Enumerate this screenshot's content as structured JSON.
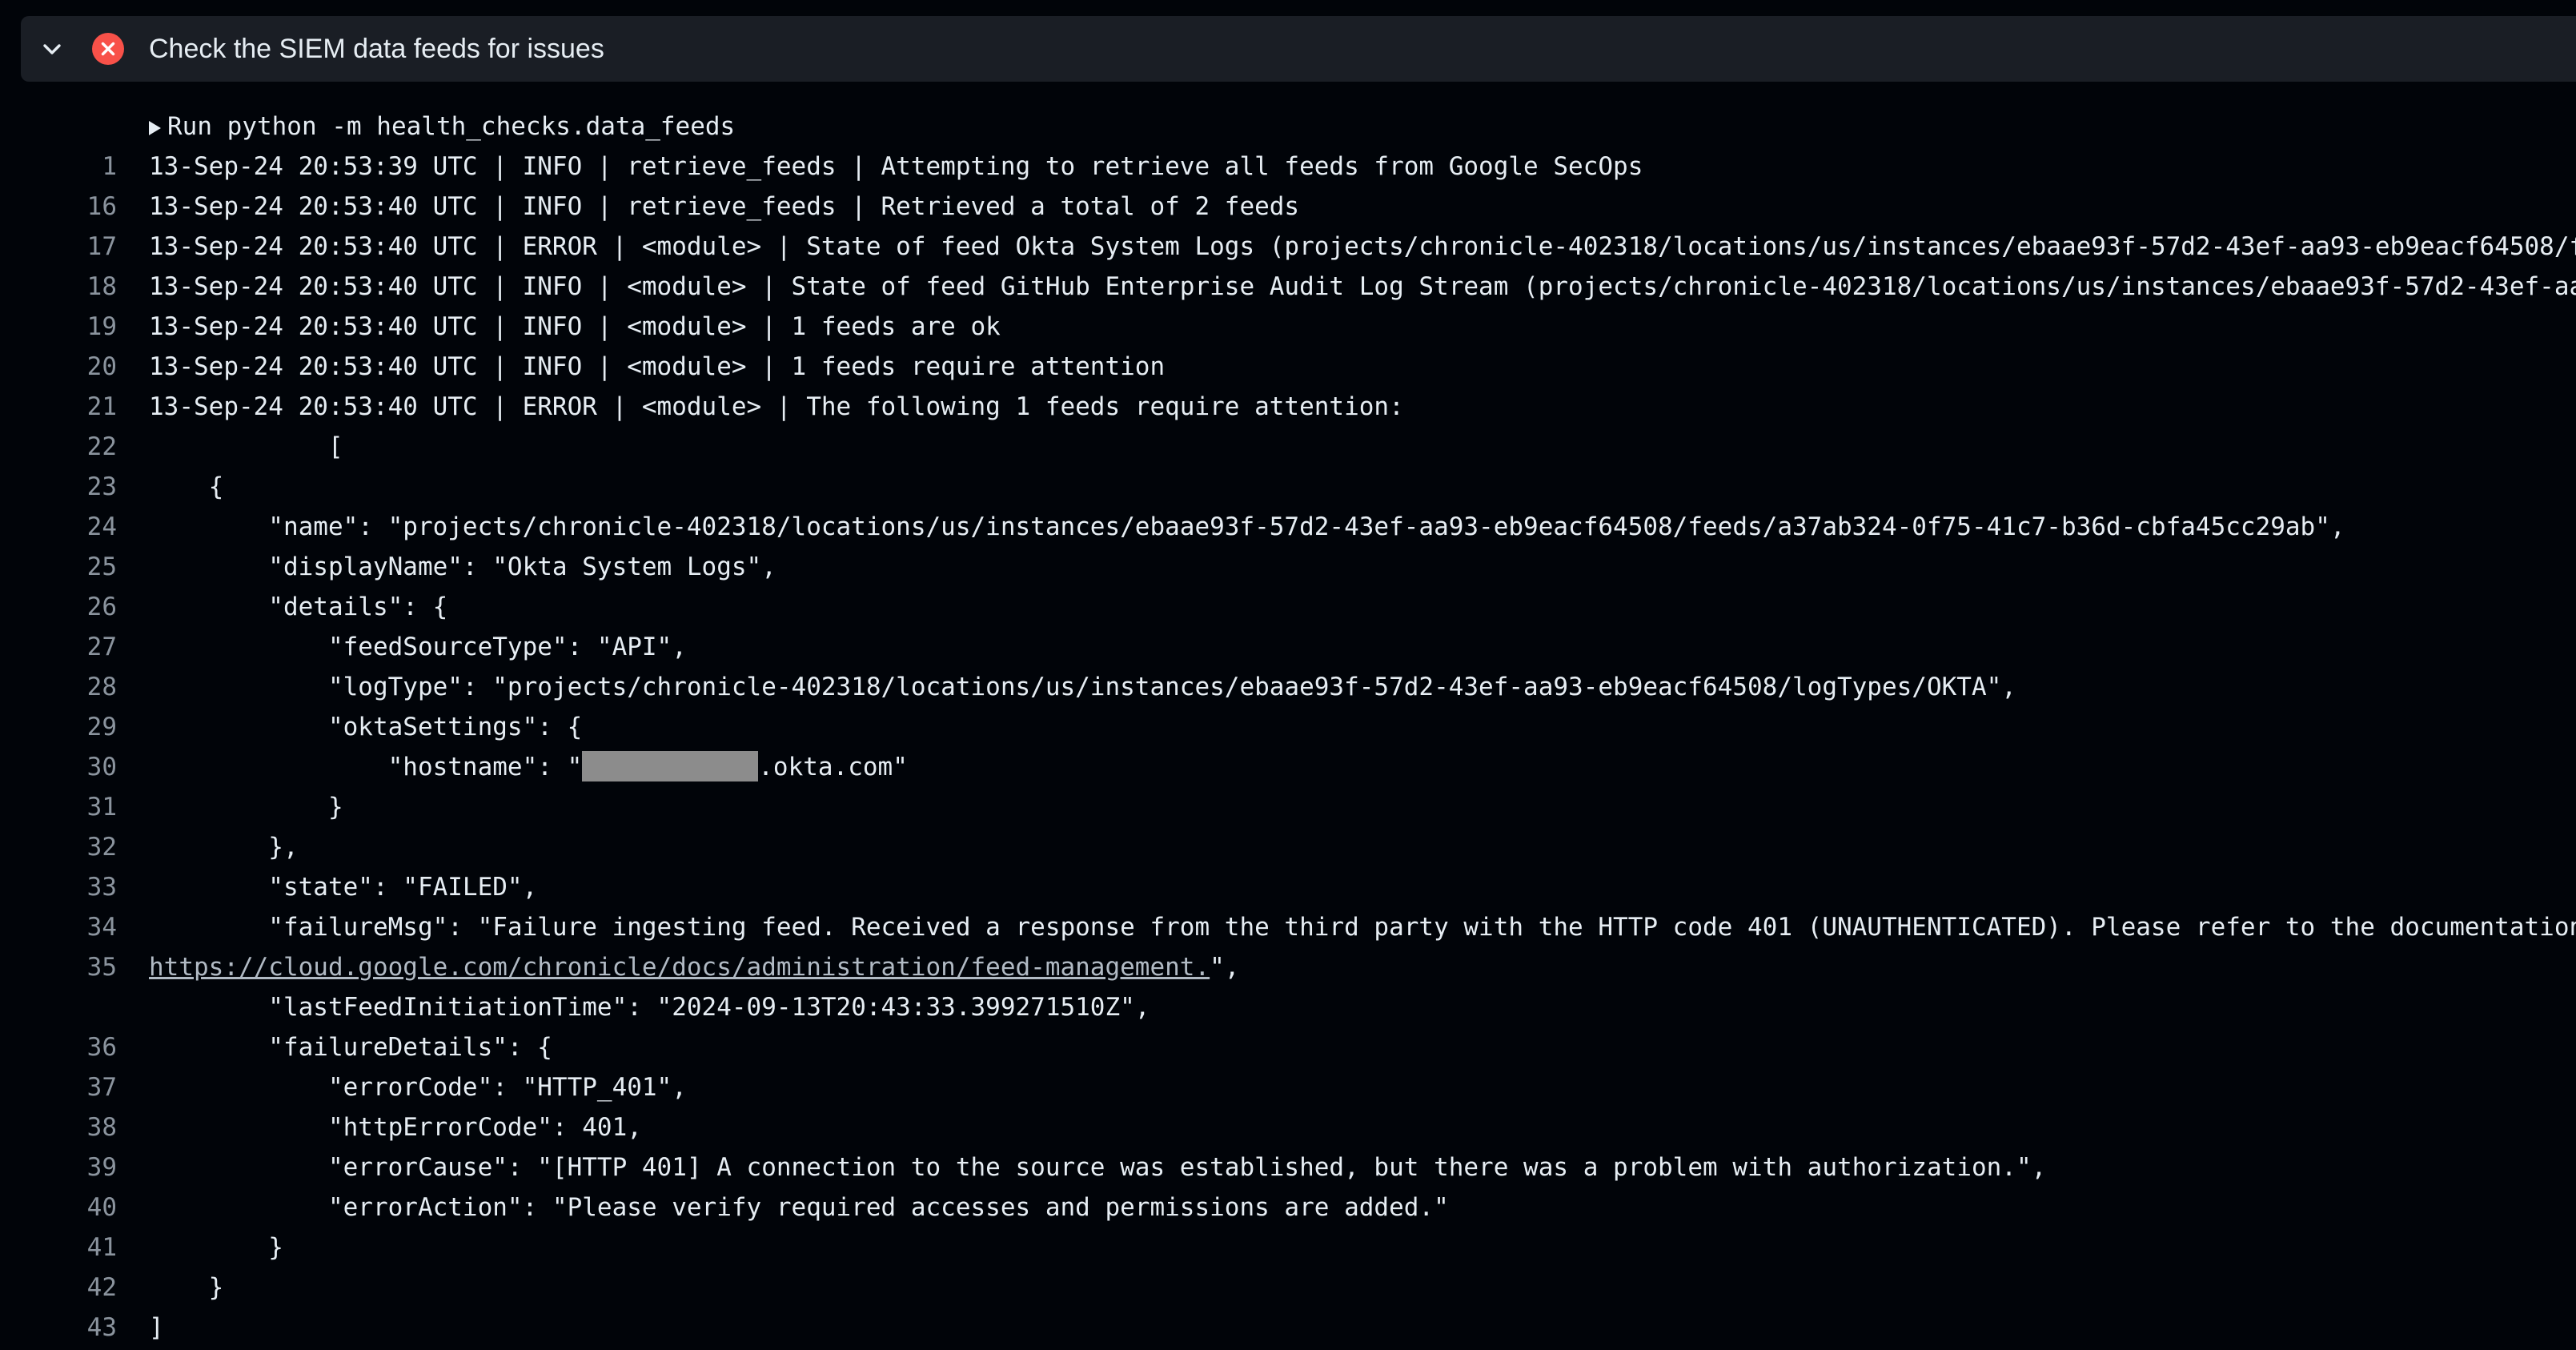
{
  "step": {
    "title": "Check the SIEM data feeds for issues",
    "status": "failed",
    "status_color": "#f85149",
    "icons": [
      "chevron-down-icon",
      "error-x-icon"
    ]
  },
  "log": {
    "run": {
      "num": "1",
      "text": "Run python -m health_checks.data_feeds"
    },
    "lines": [
      {
        "num": "16",
        "text": "13-Sep-24 20:53:39 UTC | INFO | retrieve_feeds | Attempting to retrieve all feeds from Google SecOps"
      },
      {
        "num": "17",
        "text": "13-Sep-24 20:53:40 UTC | INFO | retrieve_feeds | Retrieved a total of 2 feeds"
      },
      {
        "num": "18",
        "text": "13-Sep-24 20:53:40 UTC | ERROR | <module> | State of feed Okta System Logs (projects/chronicle-402318/locations/us/instances/ebaae93f-57d2-43ef-aa93-eb9eacf64508/feeds/"
      },
      {
        "num": "19",
        "text": "13-Sep-24 20:53:40 UTC | INFO | <module> | State of feed GitHub Enterprise Audit Log Stream (projects/chronicle-402318/locations/us/instances/ebaae93f-57d2-43ef-aa93-eb"
      },
      {
        "num": "20",
        "text": "13-Sep-24 20:53:40 UTC | INFO | <module> | 1 feeds are ok"
      },
      {
        "num": "21",
        "text": "13-Sep-24 20:53:40 UTC | INFO | <module> | 1 feeds require attention"
      },
      {
        "num": "22",
        "text": "13-Sep-24 20:53:40 UTC | ERROR | <module> | The following 1 feeds require attention:"
      },
      {
        "num": "23",
        "text": "            ["
      },
      {
        "num": "24",
        "text": "    {"
      },
      {
        "num": "25",
        "text": "        \"name\": \"projects/chronicle-402318/locations/us/instances/ebaae93f-57d2-43ef-aa93-eb9eacf64508/feeds/a37ab324-0f75-41c7-b36d-cbfa45cc29ab\","
      },
      {
        "num": "26",
        "text": "        \"displayName\": \"Okta System Logs\","
      },
      {
        "num": "27",
        "text": "        \"details\": {"
      },
      {
        "num": "28",
        "text": "            \"feedSourceType\": \"API\","
      },
      {
        "num": "29",
        "text": "            \"logType\": \"projects/chronicle-402318/locations/us/instances/ebaae93f-57d2-43ef-aa93-eb9eacf64508/logTypes/OKTA\","
      },
      {
        "num": "30",
        "text": "            \"oktaSettings\": {"
      }
    ],
    "hostname_line": {
      "num": "31",
      "prefix": "                \"hostname\": \"",
      "suffix": ".okta.com\""
    },
    "lines_b": [
      {
        "num": "32",
        "text": "            }"
      },
      {
        "num": "33",
        "text": "        },"
      },
      {
        "num": "34",
        "text": "        \"state\": \"FAILED\","
      },
      {
        "num": "35",
        "text": "        \"failureMsg\": \"Failure ingesting feed. Received a response from the third party with the HTTP code 401 (UNAUTHENTICATED). Please refer to the documentation at"
      }
    ],
    "wrap_line": {
      "link": "https://cloud.google.com/chronicle/docs/administration/feed-management.",
      "suffix": "\","
    },
    "lines_c": [
      {
        "num": "36",
        "text": "        \"lastFeedInitiationTime\": \"2024-09-13T20:43:33.399271510Z\","
      },
      {
        "num": "37",
        "text": "        \"failureDetails\": {"
      },
      {
        "num": "38",
        "text": "            \"errorCode\": \"HTTP_401\","
      },
      {
        "num": "39",
        "text": "            \"httpErrorCode\": 401,"
      },
      {
        "num": "40",
        "text": "            \"errorCause\": \"[HTTP 401] A connection to the source was established, but there was a problem with authorization.\","
      },
      {
        "num": "41",
        "text": "            \"errorAction\": \"Please verify required accesses and permissions are added.\""
      },
      {
        "num": "42",
        "text": "        }"
      },
      {
        "num": "43",
        "text": "    }"
      },
      {
        "num": "44",
        "text": "]"
      }
    ]
  }
}
